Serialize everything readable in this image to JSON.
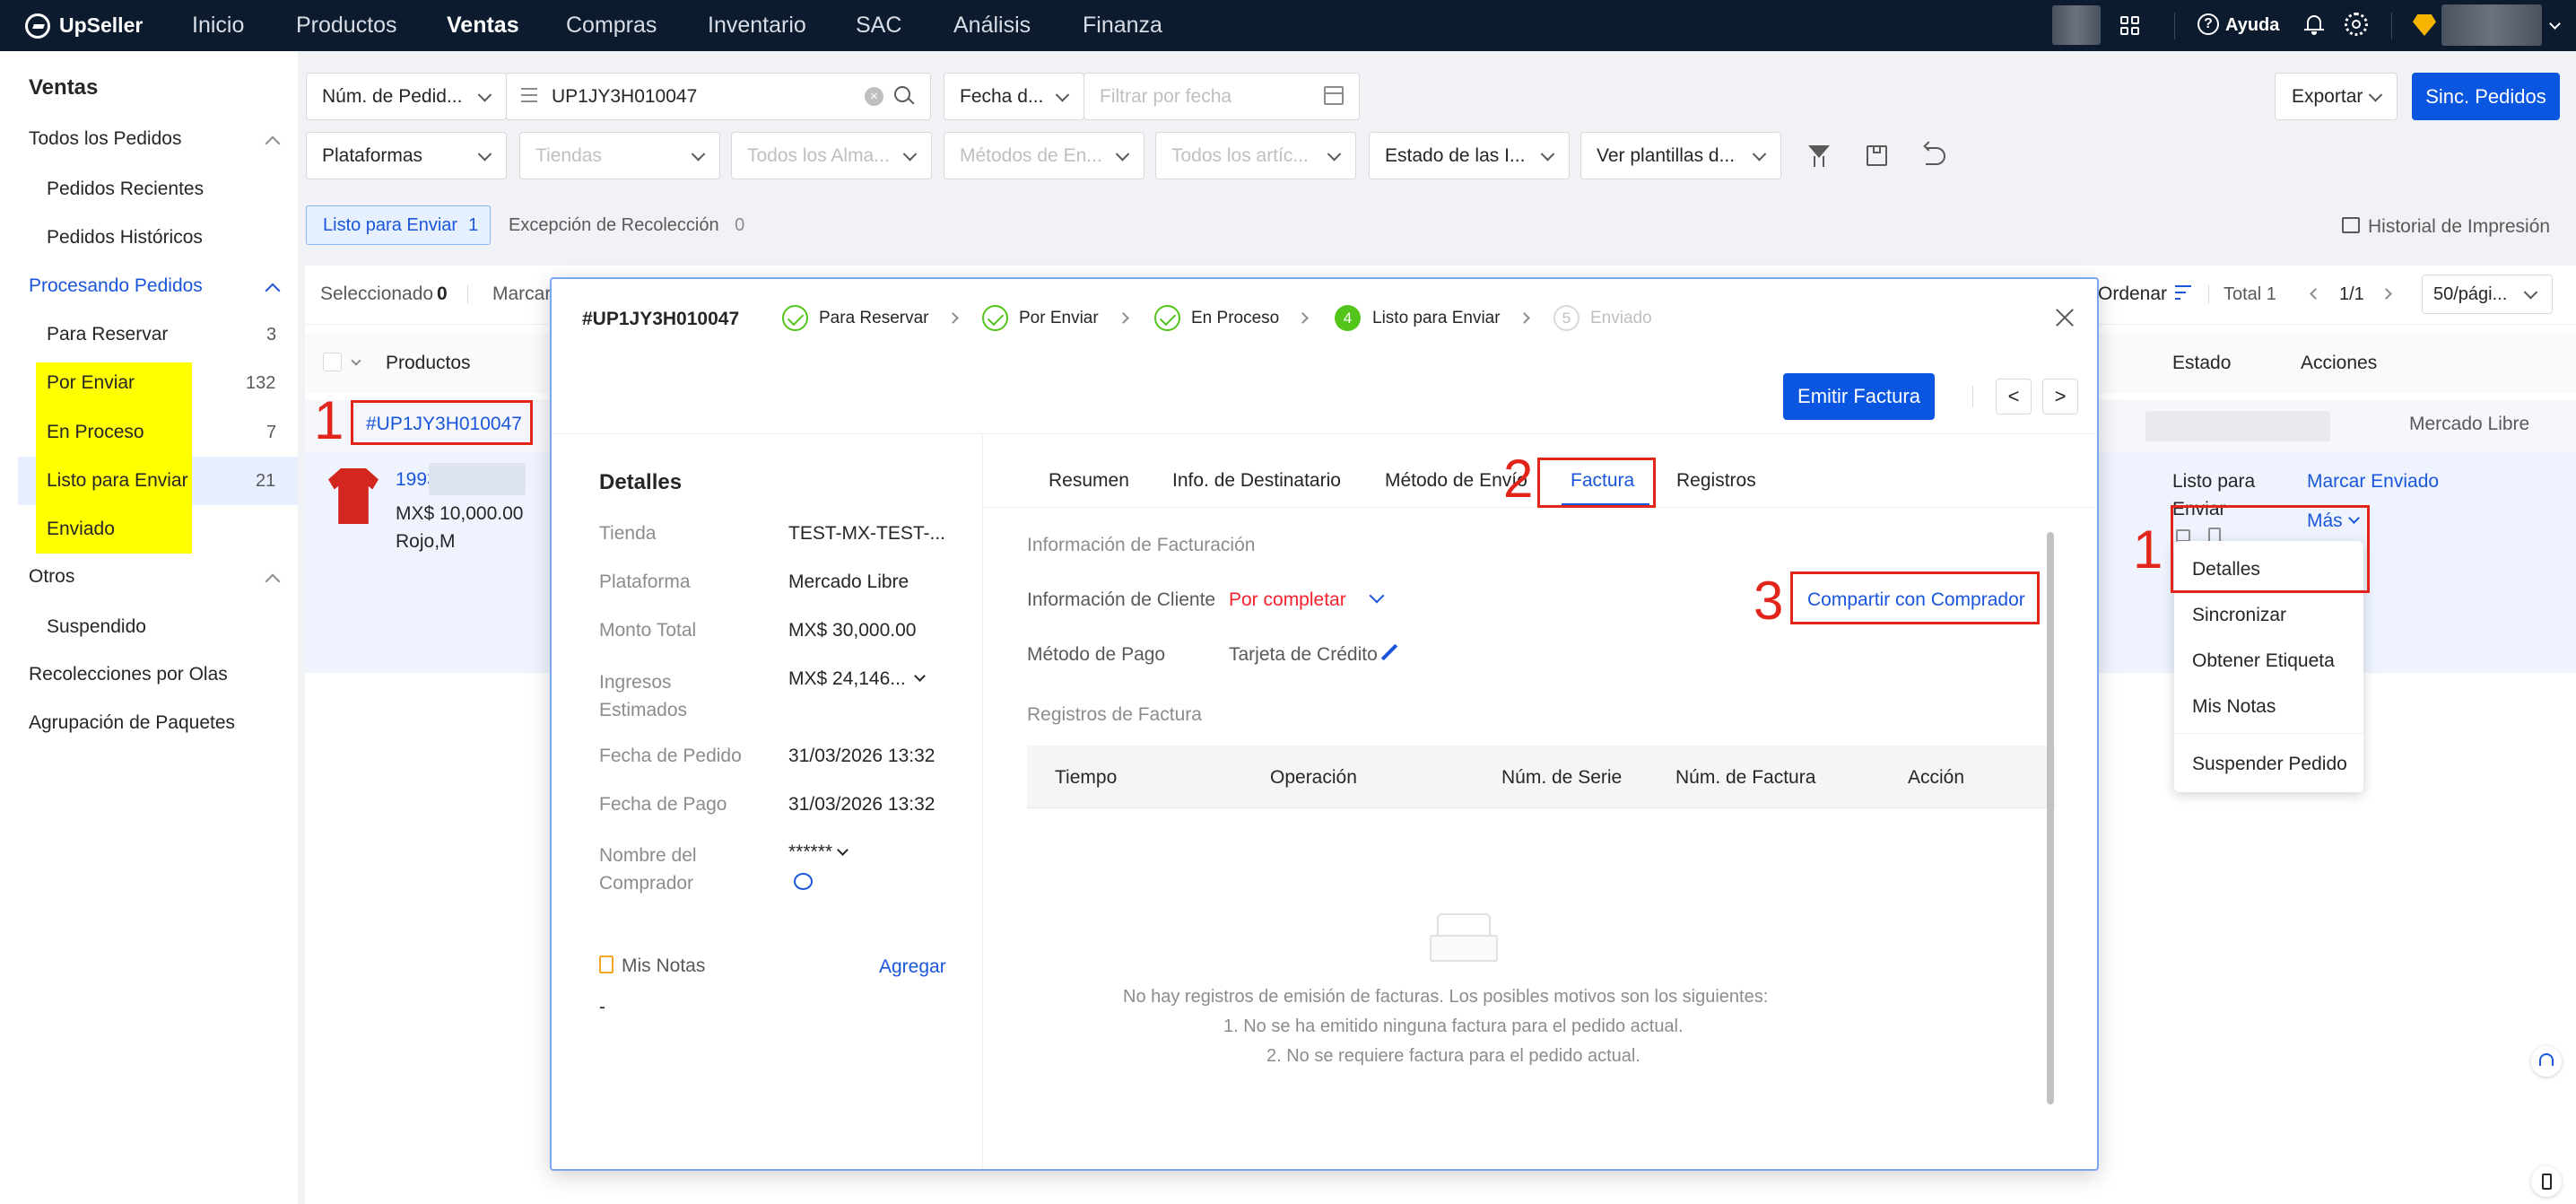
{
  "app": {
    "logo": "UpSeller"
  },
  "topnav": {
    "items": [
      "Inicio",
      "Productos",
      "Ventas",
      "Compras",
      "Inventario",
      "SAC",
      "Análisis",
      "Finanza"
    ],
    "help": "Ayuda"
  },
  "sidebar": {
    "title": "Ventas",
    "all_orders": "Todos los Pedidos",
    "recent": "Pedidos Recientes",
    "historic": "Pedidos Históricos",
    "processing": "Procesando Pedidos",
    "items": [
      {
        "label": "Para Reservar",
        "count": "3"
      },
      {
        "label": "Por Enviar",
        "count": "132"
      },
      {
        "label": "En Proceso",
        "count": "7"
      },
      {
        "label": "Listo para Enviar",
        "count": "21"
      },
      {
        "label": "Enviado",
        "count": ""
      }
    ],
    "others": "Otros",
    "suspended": "Suspendido",
    "waves": "Recolecciones por Olas",
    "packages": "Agrupación de Paquetes"
  },
  "filters": {
    "order_type": "Núm. de Pedid...",
    "search_value": "UP1JY3H010047",
    "date_type": "Fecha d...",
    "date_placeholder": "Filtrar por fecha",
    "export": "Exportar",
    "sync": "Sinc. Pedidos",
    "platforms": "Plataformas",
    "stores": "Tiendas",
    "warehouses": "Todos los Alma...",
    "shipping": "Métodos de En...",
    "articles": "Todos los artíc...",
    "status": "Estado de las I...",
    "templates": "Ver plantillas d..."
  },
  "subtabs": {
    "ready_label": "Listo para Enviar",
    "ready_count": "1",
    "exception_label": "Excepción de Recolección",
    "exception_count": "0",
    "print_history": "Historial de Impresión"
  },
  "table": {
    "selected_label": "Seleccionado",
    "selected_count": "0",
    "mark": "Marcar",
    "order": "Ordenar",
    "total": "Total 1",
    "pages": "1/1",
    "per_page": "50/pági...",
    "col_products": "Productos",
    "col_status": "Estado",
    "col_actions": "Acciones",
    "order_id": "#UP1JY3H010047",
    "platform": "Mercado Libre",
    "product_sku": "1993",
    "product_price": "MX$ 10,000.00",
    "product_variant": "Rojo,M",
    "status_line1": "Listo para",
    "status_line2": "Enviar",
    "mark_sent": "Marcar Enviado",
    "more": "Más"
  },
  "more_menu": [
    "Detalles",
    "Sincronizar",
    "Obtener Etiqueta",
    "Mis Notas",
    "Suspender Pedido"
  ],
  "modal": {
    "order_id": "#UP1JY3H010047",
    "steps": [
      {
        "label": "Para Reservar",
        "num": ""
      },
      {
        "label": "Por Enviar",
        "num": ""
      },
      {
        "label": "En Proceso",
        "num": ""
      },
      {
        "label": "Listo para Enviar",
        "num": "4"
      },
      {
        "label": "Enviado",
        "num": "5"
      }
    ],
    "emit_invoice": "Emitir Factura",
    "prev": "<",
    "next": ">",
    "details_title": "Detalles",
    "details": [
      {
        "k": "Tienda",
        "v": "TEST-MX-TEST-..."
      },
      {
        "k": "Plataforma",
        "v": "Mercado Libre"
      },
      {
        "k": "Monto Total",
        "v": "MX$ 30,000.00"
      },
      {
        "k": "Ingresos Estimados",
        "v": "MX$ 24,146..."
      },
      {
        "k": "Fecha de Pedido",
        "v": "31/03/2026 13:32"
      },
      {
        "k": "Fecha de Pago",
        "v": "31/03/2026 13:32"
      },
      {
        "k": "Nombre del Comprador",
        "v": "******"
      }
    ],
    "notes_title": "Mis Notas",
    "notes_add": "Agregar",
    "notes_value": "-",
    "tabs": [
      "Resumen",
      "Info. de Destinatario",
      "Método de Envío",
      "Factura",
      "Registros"
    ],
    "billing_info": "Información de Facturación",
    "client_info_label": "Información de Cliente",
    "client_info_value": "Por completar",
    "share": "Compartir con Comprador",
    "payment_label": "Método de Pago",
    "payment_value": "Tarjeta de Crédito",
    "records_title": "Registros de Factura",
    "record_cols": [
      "Tiempo",
      "Operación",
      "Núm. de Serie",
      "Núm. de Factura",
      "Acción"
    ],
    "empty_line1": "No hay registros de emisión de facturas. Los posibles motivos son los siguientes:",
    "empty_line2": "1. No se ha emitido ninguna factura para el pedido actual.",
    "empty_line3": "2. No se requiere factura para el pedido actual."
  },
  "annotations": {
    "n1": "1",
    "n2": "2",
    "n3": "3",
    "n1b": "1"
  },
  "colors": {
    "primary": "#0a56e0",
    "nav_bg": "#0d1b2e",
    "highlight": "#ffff00",
    "annotation": "#e1251b",
    "success": "#52c41a"
  }
}
